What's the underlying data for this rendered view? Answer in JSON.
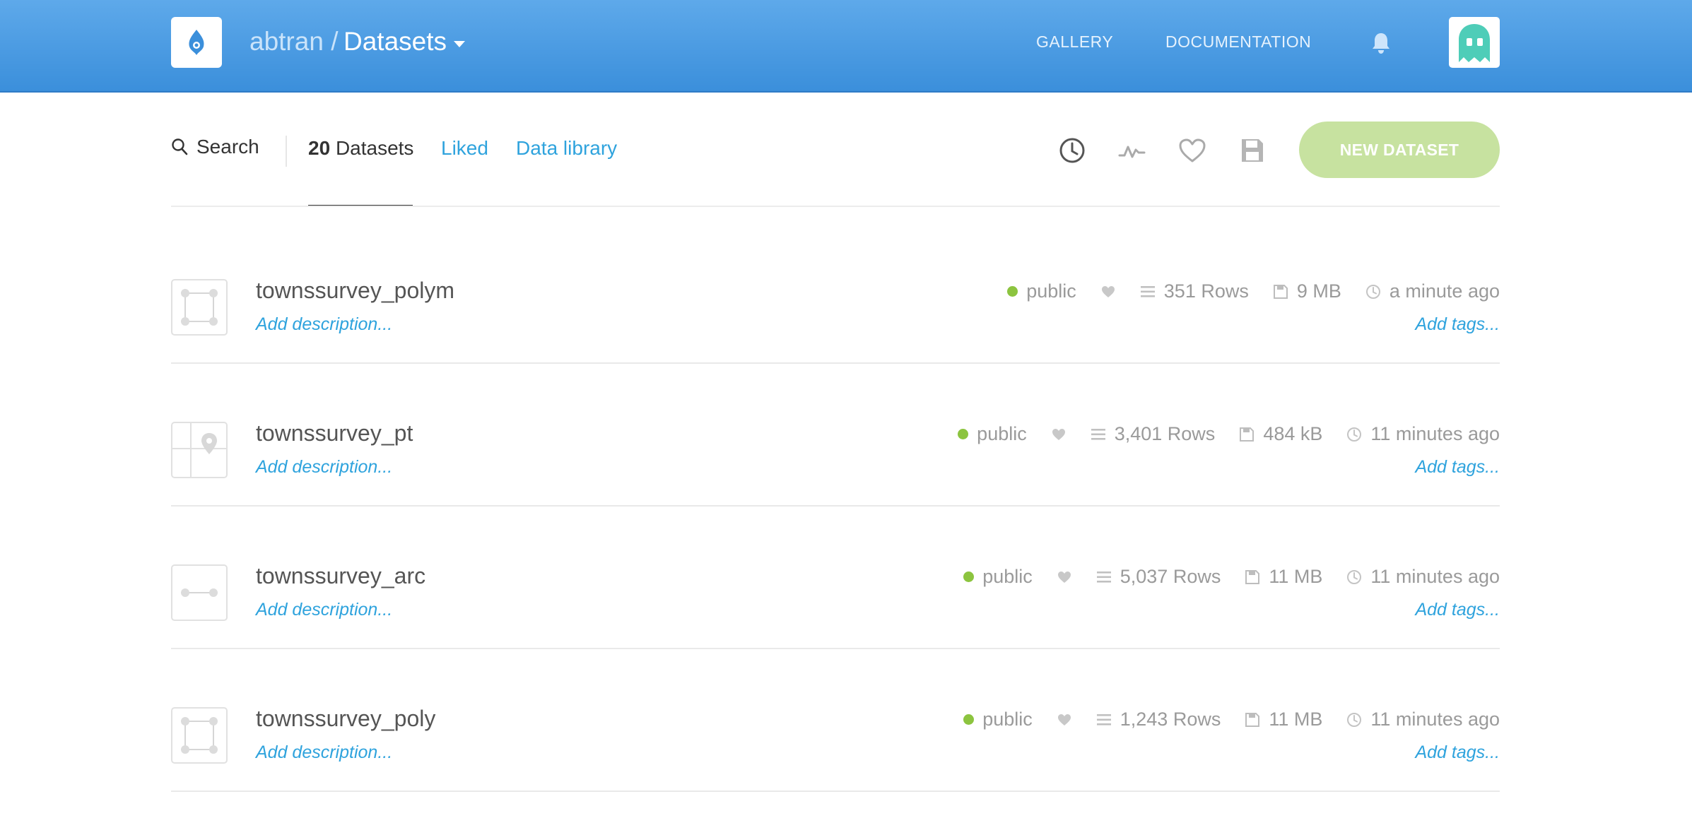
{
  "header": {
    "user": "abtran /",
    "page": "Datasets",
    "nav": {
      "gallery": "GALLERY",
      "documentation": "DOCUMENTATION"
    }
  },
  "toolbar": {
    "search_label": "Search",
    "datasets_count": "20",
    "datasets_label": "Datasets",
    "liked_label": "Liked",
    "library_label": "Data library",
    "new_dataset_label": "NEW DATASET"
  },
  "colors": {
    "header_top": "#5ea9ea",
    "header_bottom": "#3b8fdb",
    "link": "#2fa3dd",
    "public_dot": "#8cc43f",
    "new_button": "#c7e2a0"
  },
  "datasets": [
    {
      "name": "townssurvey_polym",
      "description": "Add description...",
      "privacy": "public",
      "rows": "351 Rows",
      "size": "9 MB",
      "updated": "a minute ago",
      "tags": "Add tags...",
      "thumb": "polygon-icon"
    },
    {
      "name": "townssurvey_pt",
      "description": "Add description...",
      "privacy": "public",
      "rows": "3,401 Rows",
      "size": "484 kB",
      "updated": "11 minutes ago",
      "tags": "Add tags...",
      "thumb": "map-pin-icon"
    },
    {
      "name": "townssurvey_arc",
      "description": "Add description...",
      "privacy": "public",
      "rows": "5,037 Rows",
      "size": "11 MB",
      "updated": "11 minutes ago",
      "tags": "Add tags...",
      "thumb": "line-icon"
    },
    {
      "name": "townssurvey_poly",
      "description": "Add description...",
      "privacy": "public",
      "rows": "1,243 Rows",
      "size": "11 MB",
      "updated": "11 minutes ago",
      "tags": "Add tags...",
      "thumb": "polygon-icon"
    }
  ]
}
